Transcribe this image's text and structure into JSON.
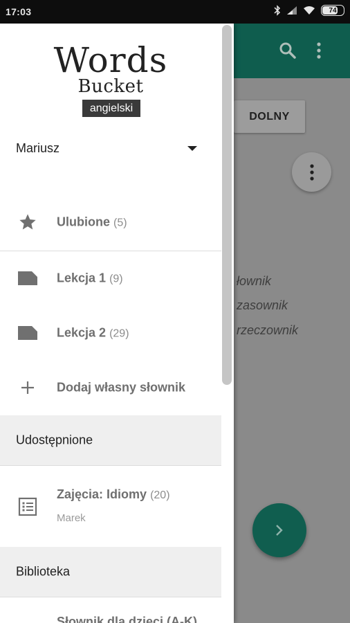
{
  "status_bar": {
    "time": "17:03",
    "battery": "74"
  },
  "app": {
    "primary_button": "DOLNY",
    "background_words": [
      "łownik",
      "zasownik",
      "rzeczownik"
    ],
    "colors": {
      "appbar": "#0f5d4e",
      "fab": "#105e4f"
    }
  },
  "drawer": {
    "logo": {
      "line1": "Words",
      "line2": "Bucket"
    },
    "language": "angielski",
    "user": "Mariusz",
    "items": [
      {
        "label": "Ulubione",
        "count": "(5)",
        "icon": "star-icon"
      },
      {
        "label": "Lekcja 1",
        "count": "(9)",
        "icon": "label-icon"
      },
      {
        "label": "Lekcja 2",
        "count": "(29)",
        "icon": "label-icon"
      },
      {
        "label": "Dodaj własny słownik",
        "count": "",
        "icon": "plus-icon"
      }
    ],
    "shared_section": "Udostępnione",
    "shared_items": [
      {
        "title": "Zajęcia: Idiomy",
        "count": "(20)",
        "author": "Marek",
        "icon": "list-icon"
      }
    ],
    "library_section": "Biblioteka",
    "library_partial": "Słownik dla dzieci (A-K)"
  }
}
